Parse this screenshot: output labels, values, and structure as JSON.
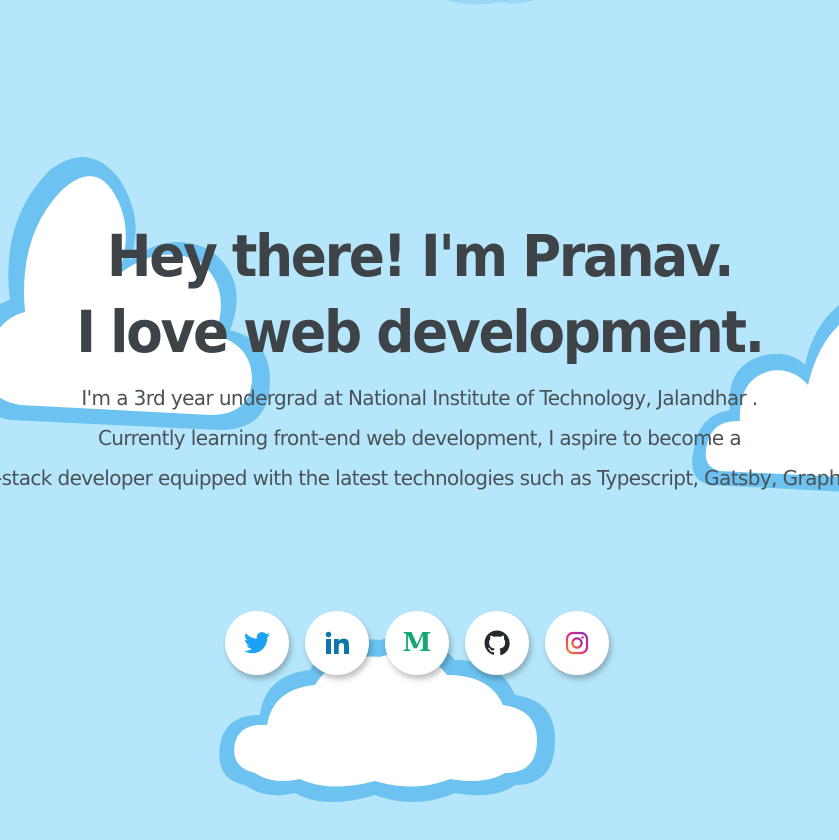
{
  "hero": {
    "headline_line1": "Hey there! I'm Pranav.",
    "headline_line2": "I love web development.",
    "bio_line1": "I'm a 3rd year undergrad at National Institute of Technology, Jalandhar .",
    "bio_line2": "Currently learning front-end web development, I aspire to become a",
    "bio_line3": "full-stack developer equipped with the latest technologies such as Typescript, Gatsby, GraphQL."
  },
  "socials": [
    {
      "name": "Twitter",
      "icon": "twitter-icon",
      "color": "#1da1f2"
    },
    {
      "name": "LinkedIn",
      "icon": "linkedin-icon",
      "color": "#0e76a8"
    },
    {
      "name": "Medium",
      "icon": "medium-icon",
      "glyph": "M",
      "color": "#12a96f"
    },
    {
      "name": "GitHub",
      "icon": "github-icon",
      "color": "#24292e"
    },
    {
      "name": "Instagram",
      "icon": "instagram-icon",
      "color": "#c13584"
    }
  ],
  "colors": {
    "background": "#b6e6fc",
    "cloud_fill": "#ffffff",
    "cloud_outline": "#6cc2f0",
    "headline": "#3d4347",
    "bio_text": "#4a5257"
  }
}
